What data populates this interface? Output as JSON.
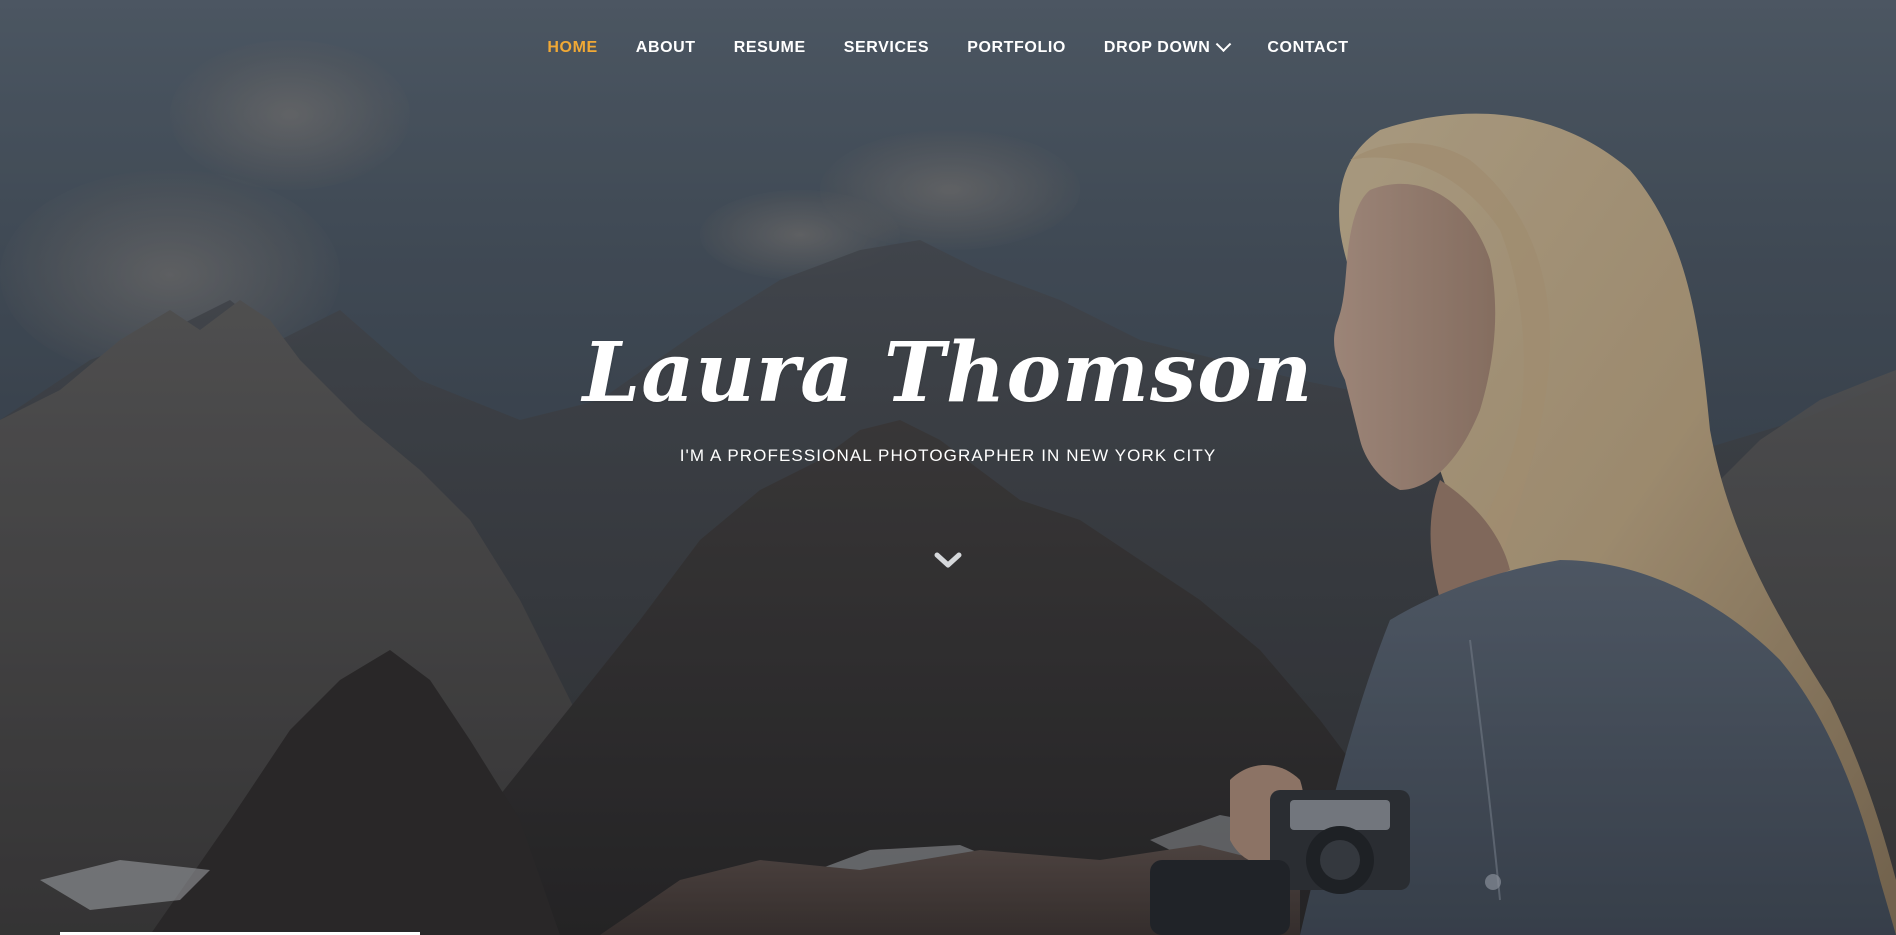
{
  "nav": {
    "items": [
      {
        "label": "HOME",
        "active": true
      },
      {
        "label": "ABOUT",
        "active": false
      },
      {
        "label": "RESUME",
        "active": false
      },
      {
        "label": "SERVICES",
        "active": false
      },
      {
        "label": "PORTFOLIO",
        "active": false
      },
      {
        "label": "DROP DOWN",
        "active": false,
        "icon": "chevron-down-icon"
      },
      {
        "label": "CONTACT",
        "active": false
      }
    ]
  },
  "hero": {
    "title": "Laura Thomson",
    "subtitle": "I'M A PROFESSIONAL PHOTOGRAPHER IN NEW YORK CITY",
    "scroll_icon": "chevron-down-icon"
  },
  "colors": {
    "accent": "#f1a935",
    "text": "#ffffff"
  }
}
